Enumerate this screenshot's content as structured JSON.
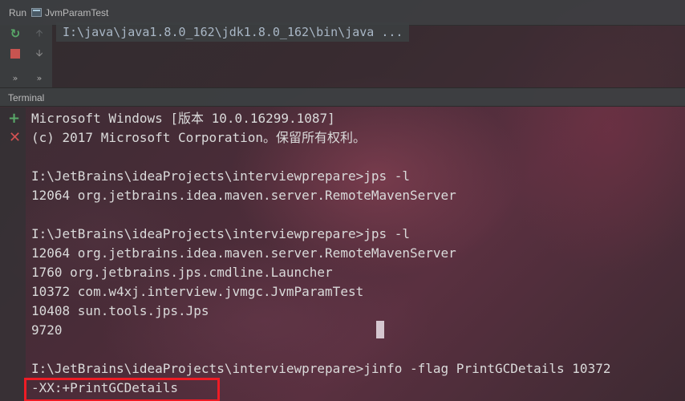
{
  "run_window": {
    "label": "Run",
    "tab_title": "JvmParamTest",
    "output_line": "I:\\java\\java1.8.0_162\\jdk1.8.0_162\\bin\\java ...",
    "more_left": "»",
    "more_right": "»"
  },
  "terminal": {
    "title": "Terminal",
    "lines": [
      "Microsoft Windows [版本 10.0.16299.1087]",
      "(c) 2017 Microsoft Corporation。保留所有权利。",
      "",
      "I:\\JetBrains\\ideaProjects\\interviewprepare>jps -l",
      "12064 org.jetbrains.idea.maven.server.RemoteMavenServer",
      "",
      "I:\\JetBrains\\ideaProjects\\interviewprepare>jps -l",
      "12064 org.jetbrains.idea.maven.server.RemoteMavenServer",
      "1760 org.jetbrains.jps.cmdline.Launcher",
      "10372 com.w4xj.interview.jvmgc.JvmParamTest",
      "10408 sun.tools.jps.Jps",
      "9720",
      "",
      "I:\\JetBrains\\ideaProjects\\interviewprepare>jinfo -flag PrintGCDetails 10372",
      "-XX:+PrintGCDetails"
    ]
  },
  "icons": {
    "rerun": "rerun-icon",
    "stop": "stop-icon",
    "scroll_up": "arrow-up-icon",
    "scroll_down": "arrow-down-icon",
    "new_session": "plus-icon",
    "close_session": "close-icon"
  },
  "colors": {
    "accent_green": "#59a869",
    "stop_red": "#c75450",
    "highlight_red": "#ee1c25",
    "terminal_text": "#dadada"
  }
}
